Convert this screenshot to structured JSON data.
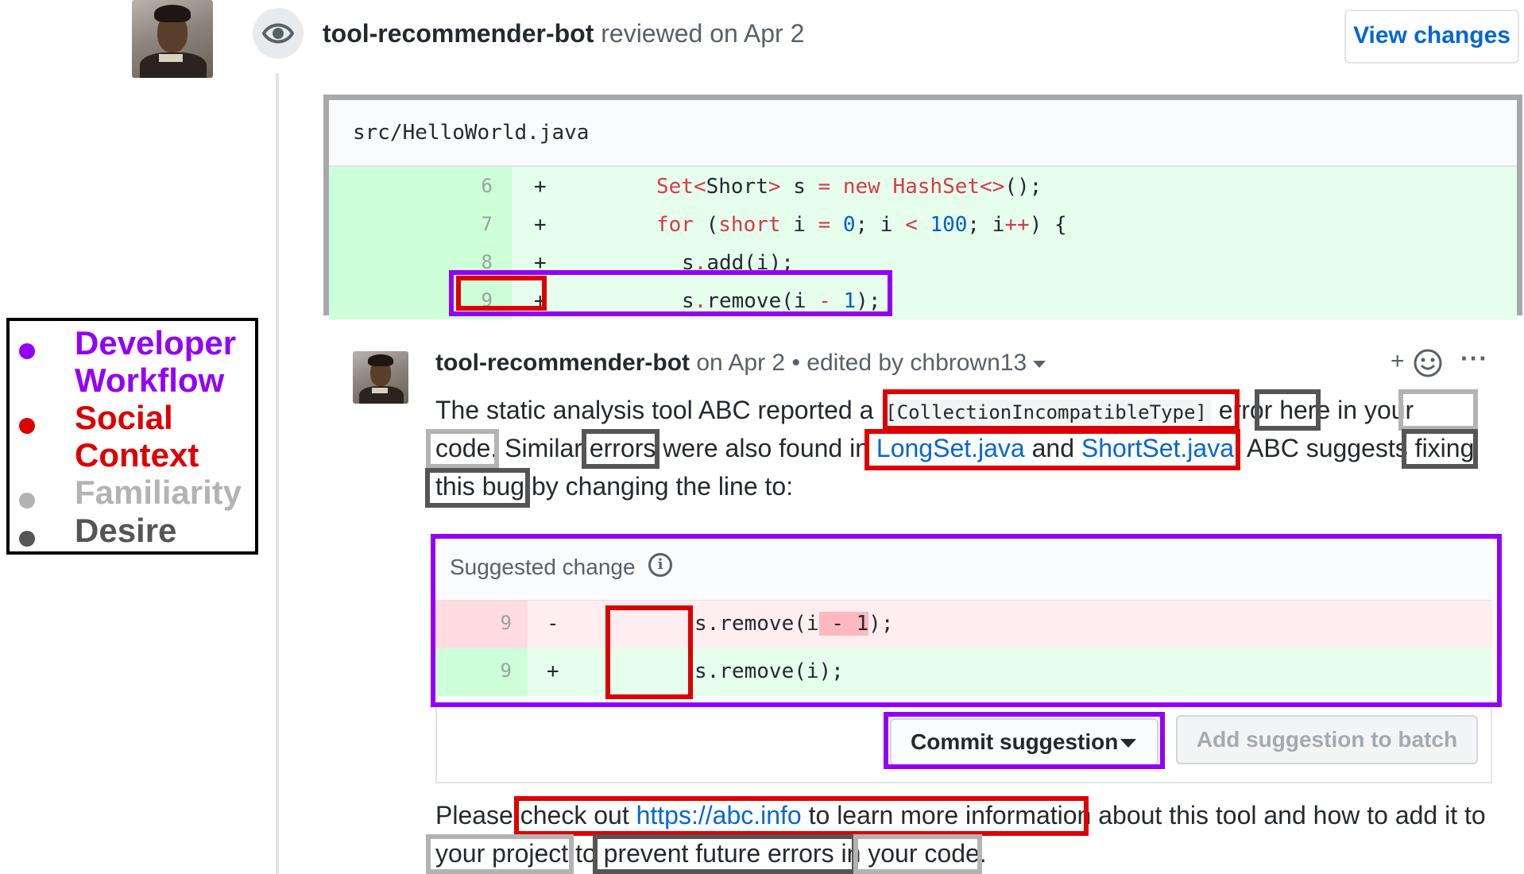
{
  "legend": {
    "items": [
      {
        "label": "Developer\nWorkflow",
        "line1": "Developer",
        "line2": "Workflow",
        "color": "#9400f5"
      },
      {
        "label": "Social Context",
        "line1": "Social",
        "line2": "Context",
        "color": "#dd0000"
      },
      {
        "label": "Familiarity",
        "line1": "Familiarity",
        "color": "#b3b3b3"
      },
      {
        "label": "Desire",
        "line1": "Desire",
        "color": "#555555"
      }
    ]
  },
  "review": {
    "author": "tool-recommender-bot",
    "action": "reviewed on Apr 2",
    "view_changes_label": "View changes",
    "icon": "eye-icon"
  },
  "file": {
    "name": "src/HelloWorld.java",
    "lines": [
      {
        "num": "6",
        "sign": "+",
        "code": "Set<Short> s = new HashSet<>();"
      },
      {
        "num": "7",
        "sign": "+",
        "code": "for (short i = 0; i < 100; i++) {"
      },
      {
        "num": "8",
        "sign": "+",
        "code": "s.add(i);"
      },
      {
        "num": "9",
        "sign": "+",
        "code": "s.remove(i - 1);"
      }
    ]
  },
  "comment": {
    "author": "tool-recommender-bot",
    "meta": "on Apr 2 • edited by chbrown13",
    "body_line1": {
      "t1": "The static analysis tool ABC reported a ",
      "code": "[CollectionIncompatibleType]",
      "t2": " ",
      "t3": "error",
      "t4": " here in ",
      "t5": "your"
    },
    "body_line2": {
      "t1": "code.",
      "t2": " Similar ",
      "t3": "errors",
      "t4": " were also found in ",
      "link1": "LongSet.java",
      "t5": " and ",
      "link2": "ShortSet.java",
      "t6": ".",
      "t7": " ABC suggests ",
      "t8": "fixing"
    },
    "body_line3": {
      "t1": "this bug",
      "t2": " by changing the line to:"
    },
    "suggested_title": "Suggested change",
    "suggestion": {
      "old": {
        "num": "9",
        "sign": "-",
        "pre": "s.remove(i",
        "del": " - 1",
        "post": ");"
      },
      "new": {
        "num": "9",
        "sign": "+",
        "code": "s.remove(i);"
      }
    },
    "commit_label": "Commit suggestion",
    "batch_label": "Add suggestion to batch",
    "footer_line1": {
      "t1": "Please ",
      "t2": "check out ",
      "link": "https://abc.info",
      "t3": " to learn more information",
      "t4": " about this tool and how to add it to"
    },
    "footer_line2": {
      "t1": "your project",
      "t2": " to ",
      "t3": "prevent future errors in",
      "t4": " ",
      "t5": "your code."
    }
  },
  "colors": {
    "developer_workflow": "#9400f5",
    "social_context": "#dd0000",
    "familiarity": "#b3b3b3",
    "desire": "#555555",
    "link": "#0366d6",
    "added_line": "#e6ffed",
    "removed_line": "#ffeef0"
  }
}
